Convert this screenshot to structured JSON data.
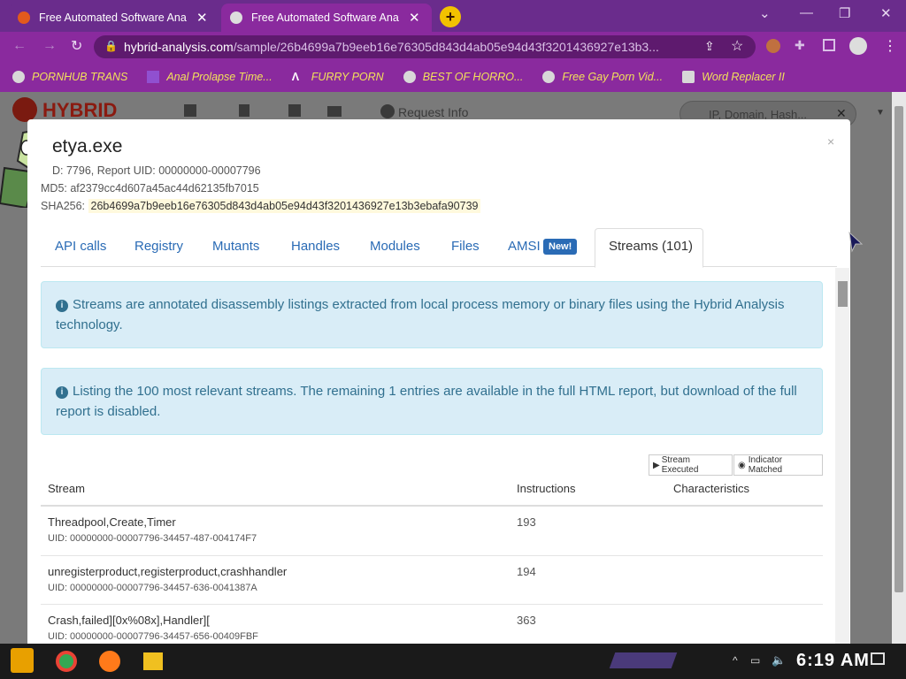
{
  "browser": {
    "tabs": [
      {
        "title": "Free Automated Software Ana",
        "active": false
      },
      {
        "title": "Free Automated Software Ana",
        "active": true
      }
    ],
    "new_tab": "+",
    "url_host": "hybrid-analysis.com",
    "url_path": "/sample/26b4699a7b9eeb16e76305d843d4ab05e94d43f3201436927e13b3...",
    "controls": {
      "minimize": "—",
      "restore": "❐",
      "close": "✕"
    }
  },
  "bookmarks": [
    {
      "label": "PORNHUB TRANS"
    },
    {
      "label": "Anal Prolapse Time..."
    },
    {
      "label": "FURRY PORN"
    },
    {
      "label": "BEST OF HORRO..."
    },
    {
      "label": "Free Gay Porn Vid..."
    },
    {
      "label": "Word Replacer II"
    }
  ],
  "site": {
    "logo": "HYBRID",
    "nav_request_info": "Request Info",
    "search_placeholder": "IP, Domain, Hash..."
  },
  "modal": {
    "title": "etya.exe",
    "pid_line": "D: 7796, Report UID: 00000000-00007796",
    "md5_line": "MD5: af2379cc4d607a45ac44d62135fb7015",
    "sha_label": "SHA256:",
    "sha_value": "26b4699a7b9eeb16e76305d843d4ab05e94d43f3201436927e13b3ebafa90739",
    "close": "×",
    "tabs": [
      "API calls",
      "Registry",
      "Mutants",
      "Handles",
      "Modules",
      "Files",
      "AMSI",
      "Streams (101)"
    ],
    "amsi_badge": "New!",
    "alert1": "Streams are annotated disassembly listings extracted from local process memory or binary files using the Hybrid Analysis technology.",
    "alert2": "Listing the 100 most relevant streams. The remaining 1 entries are available in the full HTML report, but download of the full report is disabled.",
    "legend_executed": "Stream Executed",
    "legend_matched": "Indicator Matched",
    "columns": [
      "Stream",
      "Instructions",
      "Characteristics"
    ],
    "rows": [
      {
        "name": "Threadpool,Create,Timer",
        "uid": "UID: 00000000-00007796-34457-487-004174F7",
        "instructions": "193"
      },
      {
        "name": "unregisterproduct,registerproduct,crashhandler",
        "uid": "UID: 00000000-00007796-34457-636-0041387A",
        "instructions": "194"
      },
      {
        "name": "Crash,failed][0x%08x],Handler][",
        "uid": "UID: 00000000-00007796-34457-656-00409FBF",
        "instructions": "363"
      }
    ]
  },
  "taskbar": {
    "clock": "6:19 AM"
  }
}
